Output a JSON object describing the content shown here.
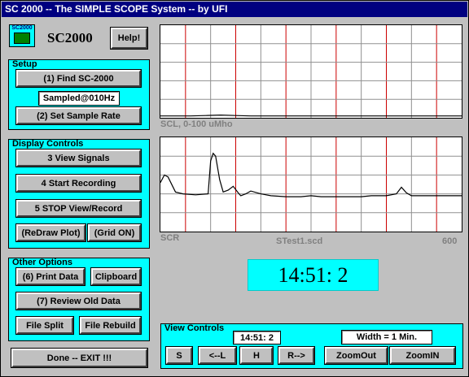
{
  "window": {
    "title": "SC 2000 -- The SIMPLE SCOPE System -- by UFI"
  },
  "app": {
    "name": "SC2000",
    "logo_text": "SC2000",
    "help_label": "Help!"
  },
  "setup": {
    "title": "Setup",
    "find_label": "(1) Find SC-2000",
    "sample_status": "Sampled@010Hz",
    "sample_rate_label": "(2) Set Sample Rate"
  },
  "display_controls": {
    "title": "Display Controls",
    "view_signals_label": "3  View Signals",
    "start_recording_label": "4 Start Recording",
    "stop_label": "5  STOP View/Record",
    "redraw_label": "(ReDraw Plot)",
    "grid_label": "(Grid ON)"
  },
  "other_options": {
    "title": "Other Options",
    "print_label": "(6) Print Data",
    "clipboard_label": "Clipboard",
    "review_label": "(7) Review Old Data",
    "split_label": "File Split",
    "rebuild_label": "File Rebuild"
  },
  "exit_label": "Done -- EXIT !!!",
  "plots": {
    "top_label": "SCL, 0-100 uMho",
    "bottom_left_label": "SCR",
    "bottom_file_label": "STest1.scd",
    "bottom_right_label": "600"
  },
  "clock": {
    "time": "14:51: 2"
  },
  "view_controls": {
    "title": "View Controls",
    "time_value": "14:51: 2",
    "width_value": "Width = 1 Min.",
    "s_label": "S",
    "left_label": "<--L",
    "h_label": "H",
    "right_label": "R-->",
    "zoomout_label": "ZoomOut",
    "zoomin_label": "ZoomIN"
  },
  "colors": {
    "panel": "#00ffff",
    "title_bar": "#000080",
    "red_line": "#cc0000"
  },
  "chart_data": [
    {
      "type": "line",
      "name": "SCL",
      "ylabel": "SCL, 0-100 uMho",
      "grid": true,
      "xlim": [
        0,
        600
      ],
      "ylim": [
        0,
        100
      ],
      "x": [
        0,
        60,
        90,
        120,
        150,
        180,
        210,
        240,
        300,
        360,
        420,
        480,
        540,
        600
      ],
      "values": [
        2,
        2,
        2.5,
        3,
        2.5,
        2,
        2,
        2,
        2,
        2,
        2,
        2,
        2,
        2
      ]
    },
    {
      "type": "line",
      "name": "SCR",
      "ylabel": "SCR",
      "xmax_label": "600",
      "grid": true,
      "xlim": [
        0,
        600
      ],
      "ylim": [
        0,
        100
      ],
      "x": [
        0,
        8,
        15,
        30,
        45,
        70,
        95,
        100,
        105,
        110,
        118,
        125,
        135,
        145,
        155,
        160,
        170,
        180,
        200,
        220,
        250,
        280,
        300,
        320,
        350,
        380,
        400,
        420,
        450,
        470,
        480,
        490,
        500,
        520,
        550,
        580,
        600
      ],
      "values": [
        52,
        60,
        58,
        42,
        40,
        39,
        40,
        75,
        83,
        80,
        55,
        42,
        44,
        48,
        41,
        38,
        40,
        43,
        40,
        38,
        37,
        37,
        38,
        37,
        37,
        37,
        37,
        38,
        38,
        40,
        47,
        41,
        38,
        38,
        38,
        38,
        38
      ]
    }
  ]
}
